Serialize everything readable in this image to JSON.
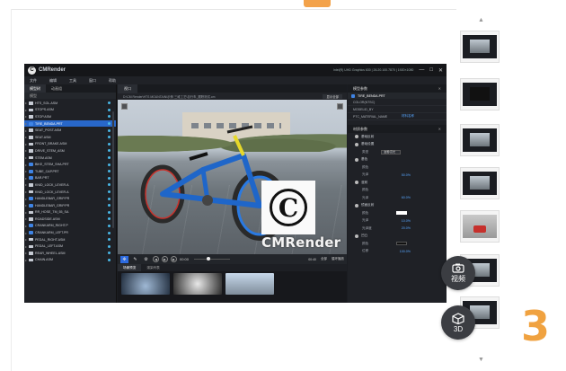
{
  "app": {
    "title": "CMRender",
    "system_info": "Intel(R) UHD Graphics 630 | 26.20.100.7870 | 1920×1080",
    "window_controls": [
      "—",
      "□",
      "✕"
    ]
  },
  "menu": [
    "文件",
    "编辑",
    "工具",
    "窗口",
    "帮助"
  ],
  "left_panel": {
    "tabs": [
      "模型树",
      "动画组"
    ],
    "header": "模型",
    "rows": [
      {
        "label": "HTS_SOL.ASM",
        "type": "folder",
        "selected": false
      },
      {
        "label": "STOPS.ASM",
        "type": "folder",
        "selected": false
      },
      {
        "label": "STOP.ASM",
        "type": "folder",
        "selected": false
      },
      {
        "label": "TIRE_BENDA.PRT",
        "type": "part",
        "selected": true
      },
      {
        "label": "SEAT_POST.ASM",
        "type": "folder",
        "selected": false
      },
      {
        "label": "SEAT.ASM",
        "type": "folder",
        "selected": false
      },
      {
        "label": "FRONT_BRAKE.ASM",
        "type": "folder",
        "selected": false
      },
      {
        "label": "DRIVE_STEM_ASM",
        "type": "folder",
        "selected": false
      },
      {
        "label": "STEM.ASM",
        "type": "folder",
        "selected": false
      },
      {
        "label": "BIKE_STEM_SHA.PRT",
        "type": "part",
        "selected": false
      },
      {
        "label": "TUBE_CAP.PRT",
        "type": "part",
        "selected": false
      },
      {
        "label": "BAR.PRT",
        "type": "part",
        "selected": false
      },
      {
        "label": "KNID_LOCK_LEVER.A",
        "type": "folder",
        "selected": false
      },
      {
        "label": "KNID_LOCK_LEVER.A",
        "type": "folder",
        "selected": false
      },
      {
        "label": "HANDLEBAR_GRIP.PR",
        "type": "part",
        "selected": false
      },
      {
        "label": "HANDLEBAR_GRIP.PR",
        "type": "part",
        "selected": false
      },
      {
        "label": "RR_HOSE_TM_55_SA",
        "type": "folder",
        "selected": false
      },
      {
        "label": "ROADSIDE.ASM",
        "type": "folder",
        "selected": false
      },
      {
        "label": "CRANKARM_RIGHT.P",
        "type": "part",
        "selected": false
      },
      {
        "label": "CRANKARM_LEFT.PR",
        "type": "part",
        "selected": false
      },
      {
        "label": "PEDAL_RIGHT.ASM",
        "type": "folder",
        "selected": false
      },
      {
        "label": "PEDAL_LEFT.ASM",
        "type": "folder",
        "selected": false
      },
      {
        "label": "REAR_WHEEL.ASM",
        "type": "folder",
        "selected": false
      },
      {
        "label": "CHAIN.ASM",
        "type": "folder",
        "selected": false
      }
    ]
  },
  "viewport": {
    "tab": "视口",
    "path": "D:\\CM Render\\HTS MOUNTAIN\\示例 三维工艺\\自行车_跟踪测试.cm",
    "mode_button": "显示全部",
    "watermark_text": "CMRender",
    "watermark_letter": "C",
    "toolbar_time": "00:00",
    "toolbar_right_1": "00:40",
    "toolbar_right_2": "全部",
    "toolbar_right_3": "循环播放",
    "bottom_tabs": [
      "场景预览",
      "渲染列表"
    ]
  },
  "properties": {
    "header": "模型参数",
    "selected_part": "TIRE_BENDA.PRT",
    "rows": [
      {
        "label": "COLOR(NTSC)",
        "value": ""
      },
      {
        "label": "MODELID_BY",
        "value": ""
      },
      {
        "label": "PTC_MATERIAL_NAME",
        "value": "材料名称"
      }
    ]
  },
  "materials": {
    "header": "材质参数",
    "section": "基础反射",
    "rows": [
      {
        "label": "基础设置",
        "kind": "group",
        "value": ""
      },
      {
        "label": "类型",
        "kind": "select",
        "value": "金属/高光"
      },
      {
        "label": "基色",
        "kind": "group",
        "value": ""
      },
      {
        "label": "颜色",
        "kind": "sub",
        "value": ""
      },
      {
        "label": "光泽",
        "kind": "sub",
        "value": "50.0%"
      },
      {
        "label": "漫射",
        "kind": "group",
        "value": ""
      },
      {
        "label": "颜色",
        "kind": "sub",
        "value": ""
      },
      {
        "label": "光泽",
        "kind": "sub",
        "value": "60.0%"
      },
      {
        "label": "镜面反射",
        "kind": "group",
        "value": ""
      },
      {
        "label": "颜色",
        "kind": "swatch-white",
        "value": ""
      },
      {
        "label": "光泽",
        "kind": "sub",
        "value": "10.0%"
      },
      {
        "label": "光泽度",
        "kind": "sub",
        "value": "20.0%"
      },
      {
        "label": "凹凸",
        "kind": "group",
        "value": ""
      },
      {
        "label": "颜色",
        "kind": "swatch-dark",
        "value": ""
      },
      {
        "label": "位移",
        "kind": "sub",
        "value": "100.0%"
      }
    ]
  },
  "side_buttons": {
    "video_label": "视频",
    "three_d_label": "3D"
  },
  "step_number": "3",
  "colors": {
    "accent_orange": "#f0a240",
    "selection_blue": "#2867c9",
    "panel_dark": "#1f2126"
  }
}
